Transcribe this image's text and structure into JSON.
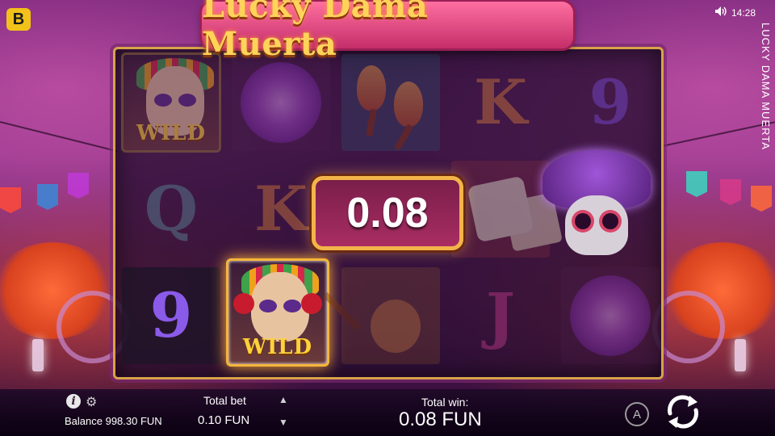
{
  "brand": {
    "logo_letter": "B"
  },
  "status": {
    "speaker_icon": "speaker-icon",
    "time": "14:28"
  },
  "game": {
    "title": "Lucky Dama Muerta",
    "side_title": "LUCKY DAMA MUERTA"
  },
  "reels": {
    "win_amount": "0.08",
    "symbols": {
      "r0c0_wild": "WILD",
      "r0c3": "K",
      "r0c4": "9",
      "r1c0": "Q",
      "r1c1": "K",
      "r2c0": "9",
      "r2c1_wild": "WILD",
      "r2c3": "J"
    }
  },
  "bottom": {
    "balance": "Balance 998.30 FUN",
    "total_bet_label": "Total bet",
    "total_bet_value": "0.10 FUN",
    "bet_up": "▲",
    "bet_down": "▼",
    "total_win_label": "Total win:",
    "total_win_value": "0.08 FUN",
    "autoplay_label": "A",
    "info_label": "i",
    "gear_glyph": "⚙"
  },
  "colors": {
    "title_gold": "#ffd35a",
    "frame_gold": "#d8a24a",
    "win_box_bg": "#a92d62",
    "letter_q": "#5a8a9a",
    "letter_k": "#d27a3a",
    "letter_9": "#7a4ad8",
    "letter_j": "#c03a8a"
  }
}
